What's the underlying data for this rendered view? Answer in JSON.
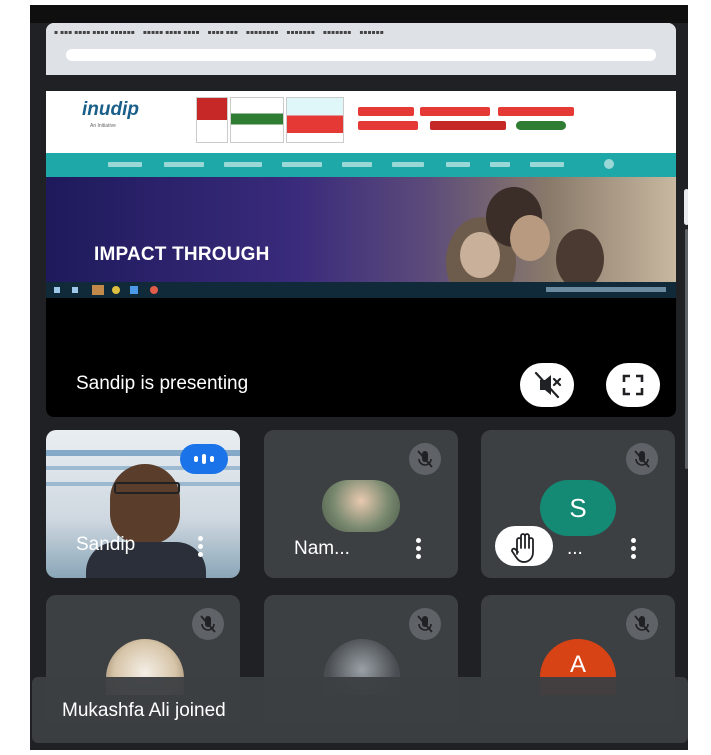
{
  "presentation": {
    "presenting_label": "Sandip  is presenting",
    "shared_screen": {
      "site_logo": "inudip",
      "site_logo_sub": "An Initiative",
      "hero_title": "IMPACT THROUGH INNOVATION"
    },
    "buttons": {
      "mute_icon": "volume-off-icon",
      "fullscreen_icon": "fullscreen-icon"
    }
  },
  "participants": [
    {
      "name": "Sandip",
      "tile_type": "video",
      "speaking": true
    },
    {
      "name": "Nam...",
      "tile_type": "avatar-photo",
      "muted": true
    },
    {
      "name": "...",
      "initial": "S",
      "avatar_color": "#148a75",
      "muted": true,
      "hand_raised": true
    },
    {
      "name": "",
      "tile_type": "avatar-photo",
      "muted": true
    },
    {
      "name": "",
      "tile_type": "avatar-photo",
      "muted": true
    },
    {
      "name": "",
      "initial": "A",
      "avatar_color": "#d84315",
      "muted": true
    }
  ],
  "notification": {
    "text": "Mukashfa Ali joined"
  },
  "colors": {
    "background": "#202124",
    "tile": "#3c4043",
    "speaking_indicator": "#1a73e8",
    "nav_teal": "#1fa8a8"
  }
}
